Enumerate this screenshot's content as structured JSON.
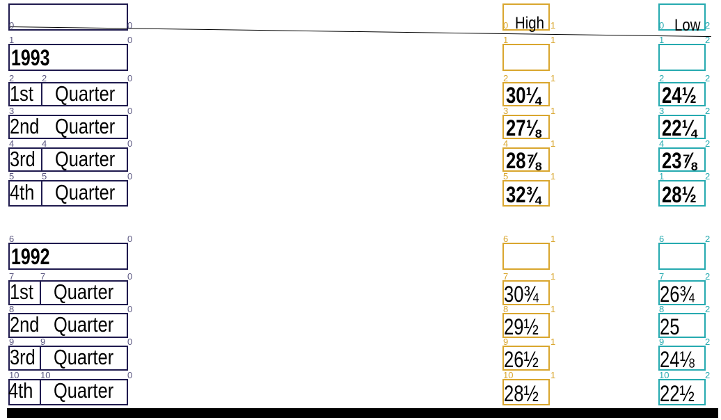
{
  "header": {
    "high": "High",
    "low": "Low"
  },
  "row_indices": [
    "0",
    "1",
    "2",
    "3",
    "4",
    "5",
    "6",
    "7",
    "8",
    "9",
    "10"
  ],
  "column_indices": [
    "0",
    "1",
    "2"
  ],
  "years": [
    {
      "year": "1993",
      "quarters": [
        {
          "ordinal": "1st",
          "word": "Quarter",
          "high": "30¼",
          "low": "24½"
        },
        {
          "ordinal": "2nd",
          "word": "Quarter",
          "high": "27⅛",
          "low": "22¼"
        },
        {
          "ordinal": "3rd",
          "word": "Quarter",
          "high": "28⅞",
          "low": "23⅞"
        },
        {
          "ordinal": "4th",
          "word": "Quarter",
          "high": "32¾",
          "low": "28½"
        }
      ]
    },
    {
      "year": "1992",
      "quarters": [
        {
          "ordinal": "1st",
          "word": "Quarter",
          "high": "30¾",
          "low": "26¾"
        },
        {
          "ordinal": "2nd",
          "word": "Quarter",
          "high": "29½",
          "low": "25"
        },
        {
          "ordinal": "3rd",
          "word": "Quarter",
          "high": "26½",
          "low": "24⅛"
        },
        {
          "ordinal": "4th",
          "word": "Quarter",
          "high": "28½",
          "low": "22½"
        }
      ]
    }
  ],
  "colors": {
    "col0": "#1f1a4e",
    "col1": "#d9a62e",
    "col2": "#26aab0"
  }
}
